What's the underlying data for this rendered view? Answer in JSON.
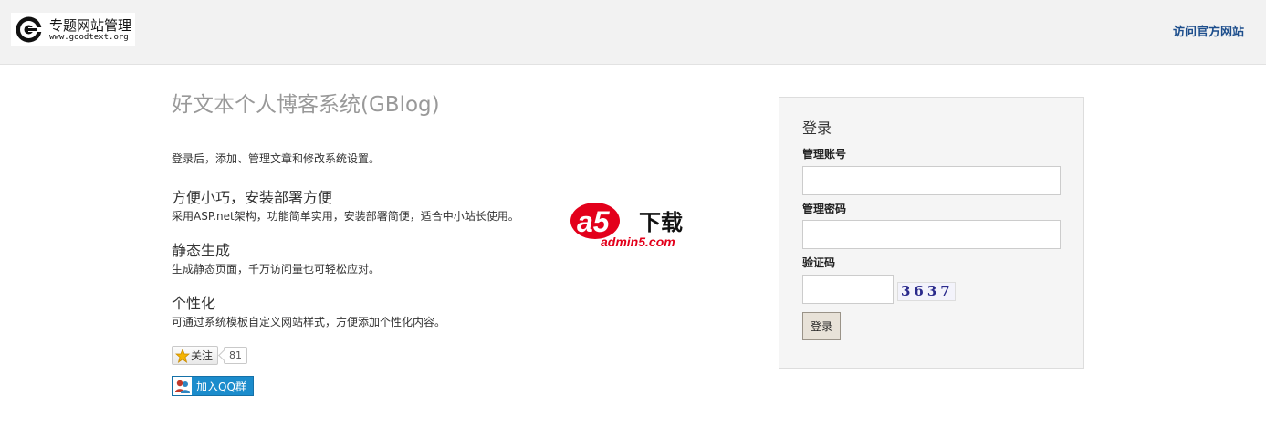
{
  "header": {
    "logo_title": "专题网站管理",
    "logo_url": "www.goodtext.org",
    "site_link": "访问官方网站"
  },
  "main": {
    "title": "好文本个人博客系统(GBlog)",
    "intro": "登录后，添加、管理文章和修改系统设置。",
    "features": [
      {
        "title": "方便小巧，安装部署方便",
        "desc": "采用ASP.net架构，功能简单实用，安装部署简便，适合中小站长使用。"
      },
      {
        "title": "静态生成",
        "desc": "生成静态页面，千万访问量也可轻松应对。"
      },
      {
        "title": "个性化",
        "desc": "可通过系统模板自定义网站样式，方便添加个性化内容。"
      }
    ],
    "follow_label": "关注",
    "follow_count": "81",
    "qq_label": "加入QQ群"
  },
  "watermark": {
    "brand": "a5",
    "tag": "下载",
    "site": "admin5.com"
  },
  "login": {
    "title": "登录",
    "account_label": "管理账号",
    "account_value": "",
    "password_label": "管理密码",
    "password_value": "",
    "captcha_label": "验证码",
    "captcha_value": "",
    "captcha_image": "3637",
    "submit_label": "登录"
  },
  "colors": {
    "link": "#1d4e8c",
    "qq_button": "#1b8ccc",
    "watermark_red": "#e3001b"
  }
}
